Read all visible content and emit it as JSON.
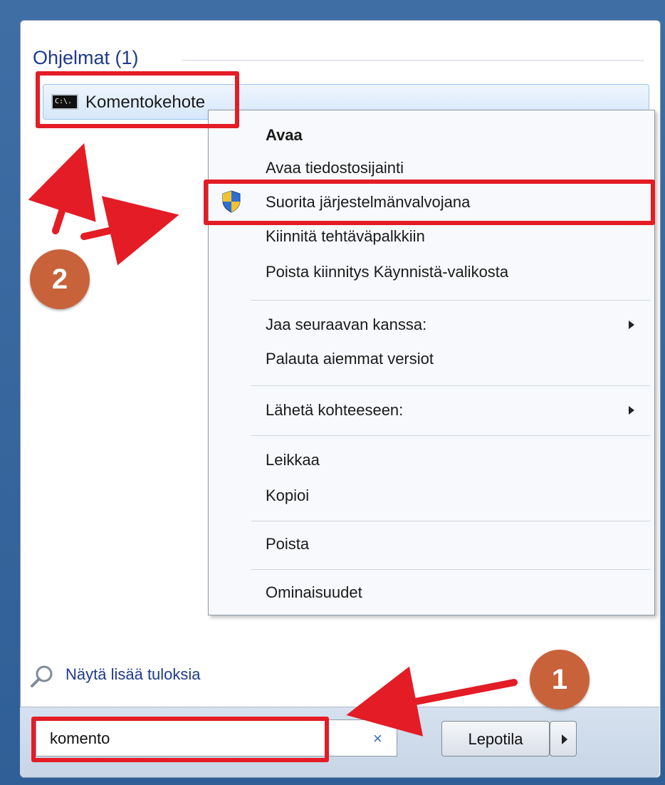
{
  "programs": {
    "header": "Ohjelmat (1)",
    "result": {
      "label": "Komentokehote",
      "icon": "command-prompt-icon",
      "icon_text": "C:\\."
    }
  },
  "context_menu": {
    "items": [
      {
        "label": "Avaa",
        "bold": true
      },
      {
        "label": "Avaa tiedostosijainti"
      },
      {
        "label": "Suorita järjestelmänvalvojana",
        "icon": "uac-shield-icon"
      },
      {
        "label": "Kiinnitä tehtäväpalkkiin"
      },
      {
        "label": "Poista kiinnitys Käynnistä-valikosta"
      },
      {
        "label": "Jaa seuraavan kanssa:",
        "submenu": true
      },
      {
        "label": "Palauta aiemmat versiot"
      },
      {
        "label": "Lähetä kohteeseen:",
        "submenu": true
      },
      {
        "label": "Leikkaa"
      },
      {
        "label": "Kopioi"
      },
      {
        "label": "Poista"
      },
      {
        "label": "Ominaisuudet"
      }
    ]
  },
  "more_results": {
    "label": "Näytä lisää tuloksia",
    "icon": "magnifier-icon"
  },
  "search": {
    "value": "komento",
    "clear_icon": "×"
  },
  "power": {
    "label": "Lepotila",
    "arrow_icon": "chevron-right-icon"
  },
  "annotations": {
    "step1": "1",
    "step2": "2",
    "highlight_color": "#e31c25",
    "badge_color": "#c8623b"
  }
}
